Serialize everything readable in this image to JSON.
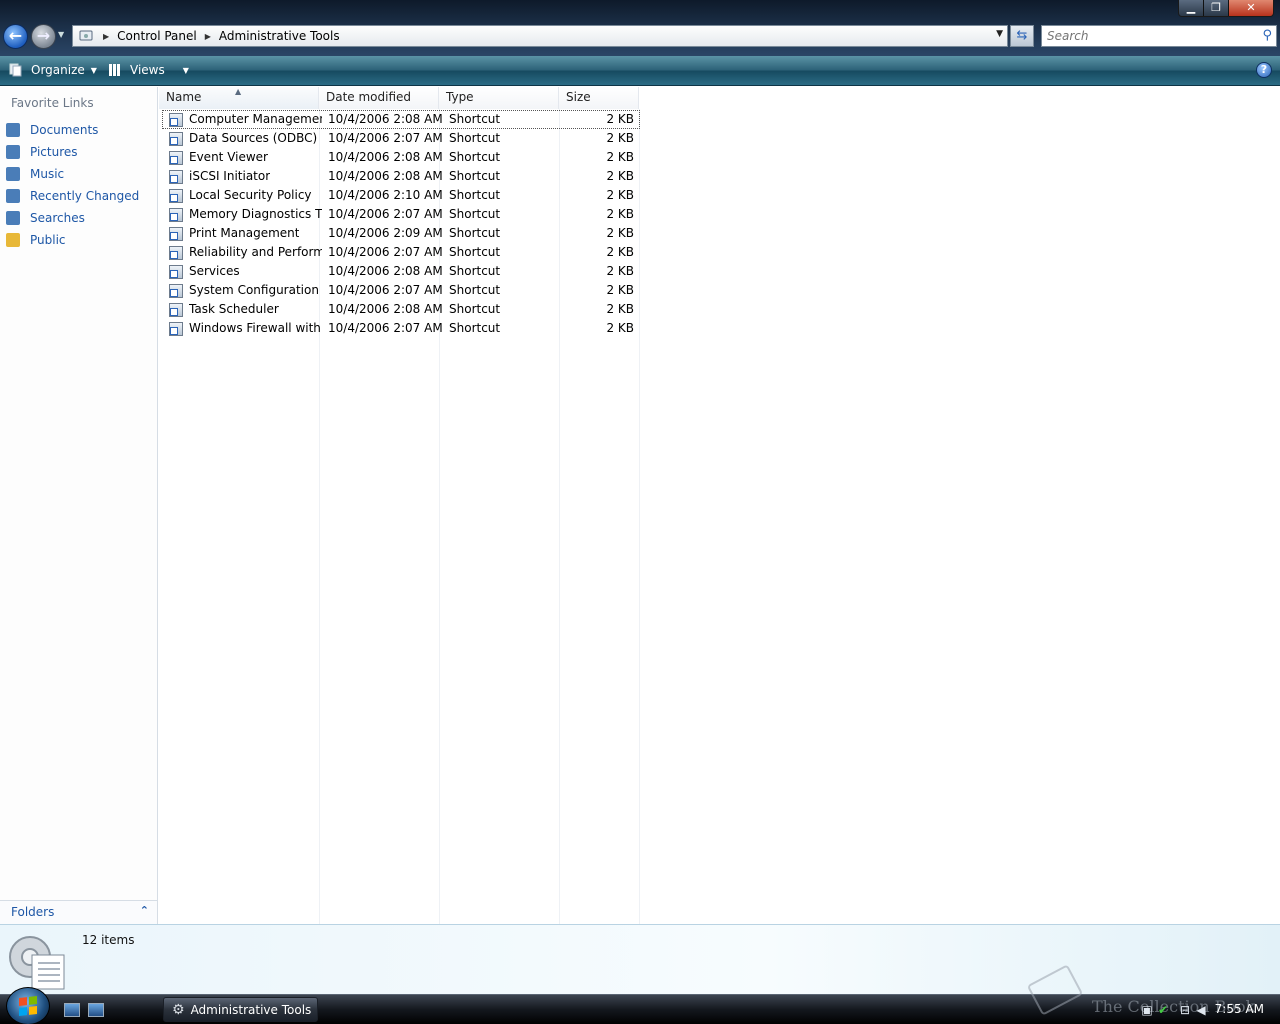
{
  "window": {
    "controls": {
      "minimize": "▁",
      "maximize": "❐",
      "close": "✕"
    }
  },
  "nav": {
    "back_glyph": "←",
    "forward_glyph": "→"
  },
  "address": {
    "crumbs": [
      "Control Panel",
      "Administrative Tools"
    ]
  },
  "search": {
    "placeholder": "Search"
  },
  "toolbar": {
    "organize_label": "Organize",
    "views_label": "Views",
    "help_label": "?"
  },
  "sidebar": {
    "title": "Favorite Links",
    "items": [
      {
        "label": "Documents",
        "icon": "documents-icon",
        "color": "#4a7db8"
      },
      {
        "label": "Pictures",
        "icon": "pictures-icon",
        "color": "#4a7db8"
      },
      {
        "label": "Music",
        "icon": "music-icon",
        "color": "#4a7db8"
      },
      {
        "label": "Recently Changed",
        "icon": "recently-changed-icon",
        "color": "#4a7db8"
      },
      {
        "label": "Searches",
        "icon": "searches-icon",
        "color": "#4a7db8"
      },
      {
        "label": "Public",
        "icon": "public-folder-icon",
        "color": "#e8b838"
      }
    ],
    "folders_label": "Folders"
  },
  "columns": [
    "Name",
    "Date modified",
    "Type",
    "Size"
  ],
  "files": [
    {
      "name": "Computer Management",
      "date": "10/4/2006 2:08 AM",
      "type": "Shortcut",
      "size": "2 KB"
    },
    {
      "name": "Data Sources (ODBC)",
      "date": "10/4/2006 2:07 AM",
      "type": "Shortcut",
      "size": "2 KB"
    },
    {
      "name": "Event Viewer",
      "date": "10/4/2006 2:08 AM",
      "type": "Shortcut",
      "size": "2 KB"
    },
    {
      "name": "iSCSI Initiator",
      "date": "10/4/2006 2:08 AM",
      "type": "Shortcut",
      "size": "2 KB"
    },
    {
      "name": "Local Security Policy",
      "date": "10/4/2006 2:10 AM",
      "type": "Shortcut",
      "size": "2 KB"
    },
    {
      "name": "Memory Diagnostics T...",
      "date": "10/4/2006 2:07 AM",
      "type": "Shortcut",
      "size": "2 KB"
    },
    {
      "name": "Print Management",
      "date": "10/4/2006 2:09 AM",
      "type": "Shortcut",
      "size": "2 KB"
    },
    {
      "name": "Reliability and Perform...",
      "date": "10/4/2006 2:07 AM",
      "type": "Shortcut",
      "size": "2 KB"
    },
    {
      "name": "Services",
      "date": "10/4/2006 2:08 AM",
      "type": "Shortcut",
      "size": "2 KB"
    },
    {
      "name": "System Configuration",
      "date": "10/4/2006 2:07 AM",
      "type": "Shortcut",
      "size": "2 KB"
    },
    {
      "name": "Task Scheduler",
      "date": "10/4/2006 2:08 AM",
      "type": "Shortcut",
      "size": "2 KB"
    },
    {
      "name": "Windows Firewall with ...",
      "date": "10/4/2006 2:07 AM",
      "type": "Shortcut",
      "size": "2 KB"
    }
  ],
  "status": {
    "item_count": "12 items"
  },
  "taskbar": {
    "task_label": "Administrative Tools",
    "clock": "7:55 AM",
    "watermark": "The Collection Book"
  }
}
